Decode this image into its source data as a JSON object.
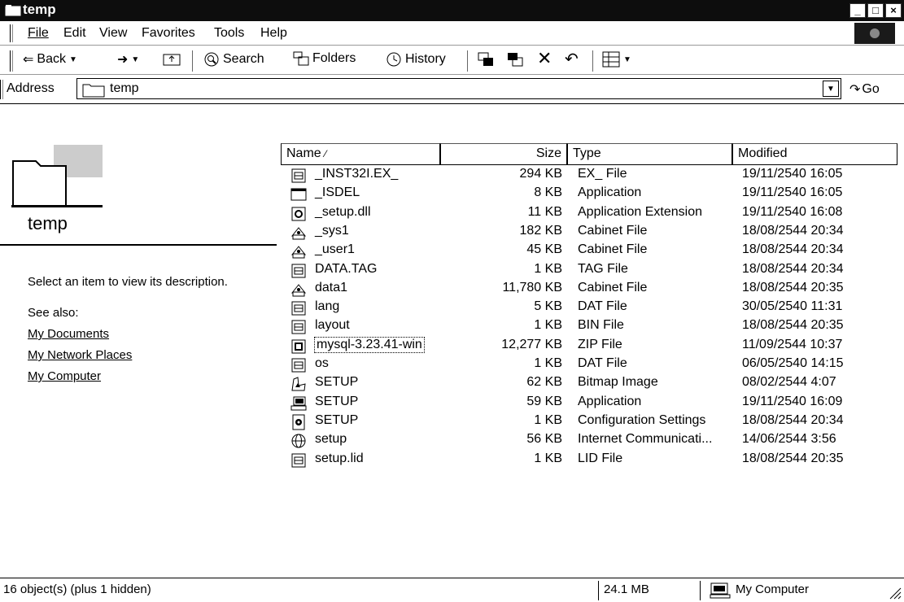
{
  "window": {
    "title": "temp"
  },
  "menu": {
    "items": [
      "File",
      "Edit",
      "View",
      "Favorites",
      "Tools",
      "Help"
    ]
  },
  "toolbar": {
    "back": "Back",
    "search": "Search",
    "folders": "Folders",
    "history": "History"
  },
  "address": {
    "label": "Address",
    "value": "temp",
    "go": "Go"
  },
  "left_pane": {
    "title": "temp",
    "description": "Select an item to view its description.",
    "see_also": "See also:",
    "links": [
      "My Documents",
      "My Network Places",
      "My Computer"
    ]
  },
  "columns": {
    "name": "Name",
    "size": "Size",
    "type": "Type",
    "modified": "Modified"
  },
  "files": [
    {
      "name": "_INST32I.EX_",
      "size": "294 KB",
      "type": "EX_ File",
      "modified": "19/11/2540 16:05",
      "icon": "generic-file-icon"
    },
    {
      "name": "_ISDEL",
      "size": "8 KB",
      "type": "Application",
      "modified": "19/11/2540 16:05",
      "icon": "application-window-icon"
    },
    {
      "name": "_setup.dll",
      "size": "11 KB",
      "type": "Application Extension",
      "modified": "19/11/2540 16:08",
      "icon": "dll-gear-icon"
    },
    {
      "name": "_sys1",
      "size": "182 KB",
      "type": "Cabinet File",
      "modified": "18/08/2544 20:34",
      "icon": "cabinet-icon"
    },
    {
      "name": "_user1",
      "size": "45 KB",
      "type": "Cabinet File",
      "modified": "18/08/2544 20:34",
      "icon": "cabinet-icon"
    },
    {
      "name": "DATA.TAG",
      "size": "1 KB",
      "type": "TAG File",
      "modified": "18/08/2544 20:34",
      "icon": "generic-file-icon"
    },
    {
      "name": "data1",
      "size": "11,780 KB",
      "type": "Cabinet File",
      "modified": "18/08/2544 20:35",
      "icon": "cabinet-icon"
    },
    {
      "name": "lang",
      "size": "5 KB",
      "type": "DAT File",
      "modified": "30/05/2540 11:31",
      "icon": "generic-file-icon"
    },
    {
      "name": "layout",
      "size": "1 KB",
      "type": "BIN File",
      "modified": "18/08/2544 20:35",
      "icon": "generic-file-icon"
    },
    {
      "name": "mysql-3.23.41-win",
      "size": "12,277 KB",
      "type": "ZIP File",
      "modified": "11/09/2544 10:37",
      "icon": "zip-file-icon"
    },
    {
      "name": "os",
      "size": "1 KB",
      "type": "DAT File",
      "modified": "06/05/2540 14:15",
      "icon": "generic-file-icon"
    },
    {
      "name": "SETUP",
      "size": "62 KB",
      "type": "Bitmap Image",
      "modified": "08/02/2544 4:07",
      "icon": "bitmap-icon"
    },
    {
      "name": "SETUP",
      "size": "59 KB",
      "type": "Application",
      "modified": "19/11/2540 16:09",
      "icon": "setup-computer-icon"
    },
    {
      "name": "SETUP",
      "size": "1 KB",
      "type": "Configuration Settings",
      "modified": "18/08/2544 20:34",
      "icon": "settings-file-icon"
    },
    {
      "name": "setup",
      "size": "56 KB",
      "type": "Internet Communicati...",
      "modified": "14/06/2544 3:56",
      "icon": "globe-icon"
    },
    {
      "name": "setup.lid",
      "size": "1 KB",
      "type": "LID File",
      "modified": "18/08/2544 20:35",
      "icon": "generic-file-icon"
    }
  ],
  "status": {
    "objects": "16 object(s) (plus 1 hidden)",
    "size": "24.1 MB",
    "zone": "My Computer"
  }
}
